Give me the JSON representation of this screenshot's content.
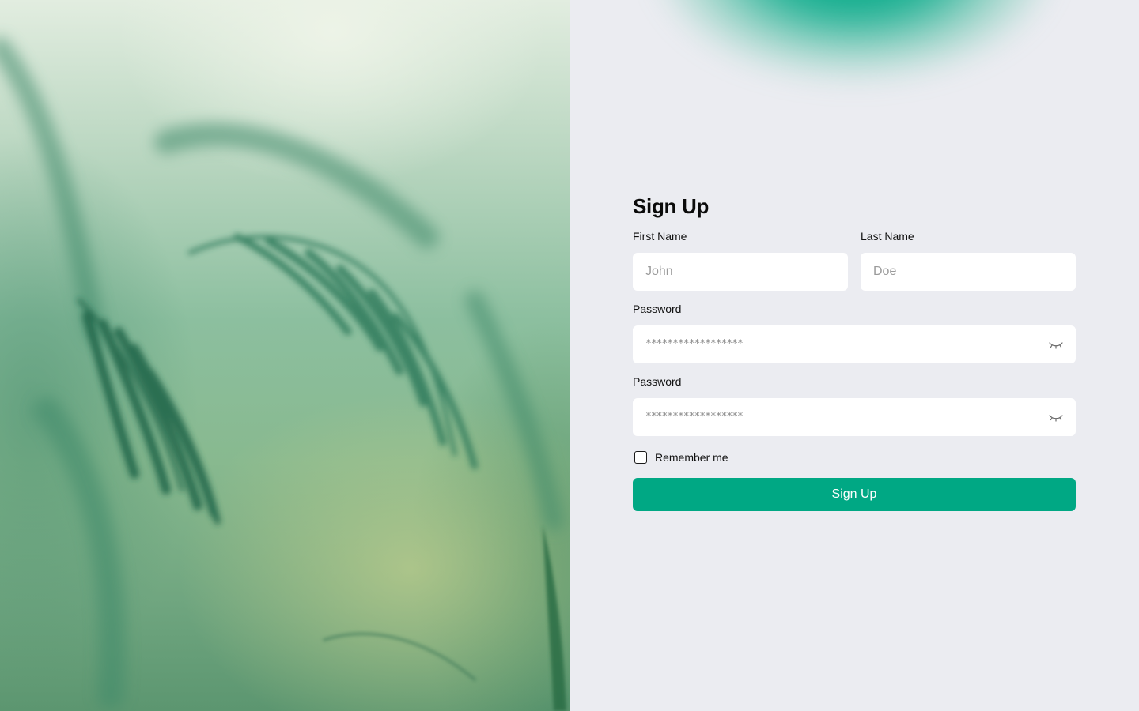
{
  "hero": {
    "icon": "plant-leaves-photo"
  },
  "signup": {
    "title": "Sign Up",
    "first_name": {
      "label": "First Name",
      "placeholder": "John",
      "value": ""
    },
    "last_name": {
      "label": "Last Name",
      "placeholder": "Doe",
      "value": ""
    },
    "password": {
      "label": "Password",
      "masked_value": "******************",
      "toggle_icon": "eye-closed-icon"
    },
    "confirm_password": {
      "label": "Password",
      "masked_value": "******************",
      "toggle_icon": "eye-closed-icon"
    },
    "remember": {
      "label": "Remember me",
      "checked": false
    },
    "submit_label": "Sign Up"
  },
  "colors": {
    "accent": "#00a884",
    "panel_bg": "#ebecf1",
    "input_bg": "#ffffff",
    "text": "#111111"
  }
}
